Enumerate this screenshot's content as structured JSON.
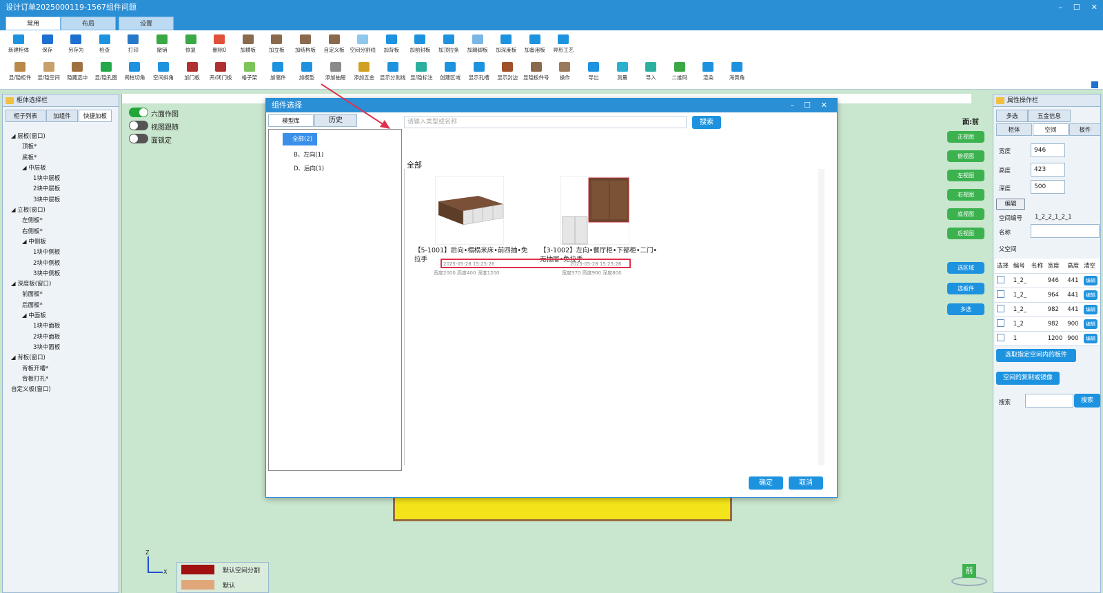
{
  "window": {
    "title": "设计订单2025000119-1567组件问题",
    "controls": [
      "–",
      "☐",
      "✕"
    ]
  },
  "main_tabs": [
    "常用",
    "布局",
    "设置"
  ],
  "toolbar_row1": [
    {
      "label": "新建柜体",
      "color": "#1d93e0"
    },
    {
      "label": "保存",
      "color": "#1d6fd0"
    },
    {
      "label": "另存为",
      "color": "#1d6fd0"
    },
    {
      "label": "检查",
      "color": "#1d93e0"
    },
    {
      "label": "打印",
      "color": "#2878c8"
    },
    {
      "label": "撤销",
      "color": "#3aa845"
    },
    {
      "label": "恢复",
      "color": "#3aa845"
    },
    {
      "label": "删除0",
      "color": "#e0503a"
    },
    {
      "label": "加横板",
      "color": "#8a6a4c"
    },
    {
      "label": "加立板",
      "color": "#8a6a4c"
    },
    {
      "label": "加结构板",
      "color": "#8a6a4c"
    },
    {
      "label": "自定义板",
      "color": "#8a6a4c"
    },
    {
      "label": "空间分割线",
      "color": "#8fc8ee"
    },
    {
      "label": "加背板",
      "color": "#1d93e0"
    },
    {
      "label": "加前封板",
      "color": "#1d93e0"
    },
    {
      "label": "加顶拉条",
      "color": "#1d93e0"
    },
    {
      "label": "加踢脚板",
      "color": "#7ab7e5"
    },
    {
      "label": "加深度板",
      "color": "#1d93e0"
    },
    {
      "label": "加备用板",
      "color": "#1d93e0"
    },
    {
      "label": "异形工艺",
      "color": "#1d93e0"
    }
  ],
  "toolbar_row2": [
    {
      "label": "显/隐柜件",
      "color": "#b98a4a"
    },
    {
      "label": "显/隐空间",
      "color": "#c8a06a"
    },
    {
      "label": "隐藏选中",
      "color": "#a07040"
    },
    {
      "label": "显/隐孔图",
      "color": "#23a84a"
    },
    {
      "label": "阅柱切角",
      "color": "#1d93e0"
    },
    {
      "label": "空间斜角",
      "color": "#1d93e0"
    },
    {
      "label": "加门板",
      "color": "#b03030"
    },
    {
      "label": "开/闭门板",
      "color": "#b03030"
    },
    {
      "label": "格子架",
      "color": "#7cc45a"
    },
    {
      "label": "加储件",
      "color": "#1d93e0"
    },
    {
      "label": "加楔型",
      "color": "#1d93e0"
    },
    {
      "label": "添加抽屉",
      "color": "#8a8a8a"
    },
    {
      "label": "添加五金",
      "color": "#d0a020"
    },
    {
      "label": "显示分割线",
      "color": "#1d93e0"
    },
    {
      "label": "显/隐标注",
      "color": "#2bb0a0"
    },
    {
      "label": "创建区域",
      "color": "#1d93e0"
    },
    {
      "label": "显示孔槽",
      "color": "#1d93e0"
    },
    {
      "label": "显示封边",
      "color": "#a0502a"
    },
    {
      "label": "显隐板件号",
      "color": "#8a6a4c"
    },
    {
      "label": "操作",
      "color": "#9a7a5a"
    },
    {
      "label": "导出",
      "color": "#1d93e0"
    },
    {
      "label": "测量",
      "color": "#2bb0d0"
    },
    {
      "label": "导入",
      "color": "#2bb0a0"
    },
    {
      "label": "二维码",
      "color": "#3aa845"
    },
    {
      "label": "渲染",
      "color": "#1d93e0"
    },
    {
      "label": "海黄角",
      "color": "#1d93e0"
    }
  ],
  "left_panel": {
    "title": "柜体选择栏",
    "tabs": [
      "柜子列表",
      "加组件",
      "快捷加板"
    ],
    "tree": [
      {
        "label": "◢ 层板(窗口)",
        "indent": 0
      },
      {
        "label": "顶板*",
        "indent": 1
      },
      {
        "label": "底板*",
        "indent": 1
      },
      {
        "label": "◢ 中层板",
        "indent": 1
      },
      {
        "label": "1块中层板",
        "indent": 2
      },
      {
        "label": "2块中层板",
        "indent": 2
      },
      {
        "label": "3块中层板",
        "indent": 2
      },
      {
        "label": "◢ 立板(窗口)",
        "indent": 0
      },
      {
        "label": "左侧板*",
        "indent": 1
      },
      {
        "label": "右侧板*",
        "indent": 1
      },
      {
        "label": "◢ 中侧板",
        "indent": 1
      },
      {
        "label": "1块中侧板",
        "indent": 2
      },
      {
        "label": "2块中侧板",
        "indent": 2
      },
      {
        "label": "3块中侧板",
        "indent": 2
      },
      {
        "label": "◢ 深度板(窗口)",
        "indent": 0
      },
      {
        "label": "前面板*",
        "indent": 1
      },
      {
        "label": "后面板*",
        "indent": 1
      },
      {
        "label": "◢ 中面板",
        "indent": 1
      },
      {
        "label": "1块中面板",
        "indent": 2
      },
      {
        "label": "2块中面板",
        "indent": 2
      },
      {
        "label": "3块中面板",
        "indent": 2
      },
      {
        "label": "◢ 背板(窗口)",
        "indent": 0
      },
      {
        "label": "背板开槽*",
        "indent": 1
      },
      {
        "label": "背板打孔*",
        "indent": 1
      },
      {
        "label": "自定义板(窗口)",
        "indent": 0
      }
    ]
  },
  "canvas": {
    "toggles": [
      {
        "label": "六面作图",
        "on": true
      },
      {
        "label": "视图跟随",
        "on": false
      },
      {
        "label": "面锁定",
        "on": false
      }
    ],
    "face_label": "面:前",
    "view_buttons": [
      "正视图",
      "俯视图",
      "左视图",
      "右视图",
      "底视图",
      "后视图"
    ],
    "select_buttons": [
      "选区域",
      "选板件",
      "多选"
    ],
    "legend": [
      {
        "label": "默认空间分割",
        "color": "#a01010"
      },
      {
        "label": "默认",
        "color": "#e0a87a"
      }
    ],
    "axes": {
      "z": "Z",
      "x": "X"
    },
    "cube_label": "前"
  },
  "dialog": {
    "title": "组件选择",
    "tabs": [
      "模型库",
      "历史"
    ],
    "search_placeholder": "请输入类型或名称",
    "search_button": "搜索",
    "tree": [
      "全部(2)",
      "B、左向(1)",
      "D、后向(1)"
    ],
    "section_title": "全部",
    "items": [
      {
        "name": "【5-1001】后向•榻榻米床•前四抽•免拉手",
        "date": "2025-05-28 15:25:26",
        "dims": "宽度2000 高度400 深度1200"
      },
      {
        "name": "【3-1002】左向•餐厅柜•下部柜•二门•无抽屉•免拉手",
        "date": "2025-05-28 15:25:26",
        "dims": "宽度370 高度900 深度800"
      }
    ],
    "ok": "确定",
    "cancel": "取消"
  },
  "right_panel": {
    "title": "属性操作栏",
    "tabs_row1": [
      "多选",
      "五金信息"
    ],
    "tabs_row2": [
      "柜体",
      "空间",
      "板件"
    ],
    "fields": [
      {
        "label": "宽度",
        "value": "946"
      },
      {
        "label": "高度",
        "value": "423"
      },
      {
        "label": "深度",
        "value": "500"
      }
    ],
    "edit_button": "编辑",
    "space_no_label": "空间编号",
    "space_no_value": "1_2_2_1_2_1",
    "name_label": "名称",
    "parent_label": "父空间",
    "table_headers": [
      "选择",
      "编号",
      "名称",
      "宽度",
      "高度",
      "清空"
    ],
    "table_rows": [
      {
        "id": "1_2_",
        "w": "946",
        "h": "441"
      },
      {
        "id": "1_2_",
        "w": "964",
        "h": "441"
      },
      {
        "id": "1_2_",
        "w": "982",
        "h": "441"
      },
      {
        "id": "1_2",
        "w": "982",
        "h": "900"
      },
      {
        "id": "1",
        "w": "1200",
        "h": "900"
      }
    ],
    "row_edit_label": "编辑",
    "btn_select_in_space": "选取指定空间内的板件",
    "btn_copy_mirror": "空间的复制或镜像",
    "search_label": "搜索",
    "search_button": "搜索"
  }
}
